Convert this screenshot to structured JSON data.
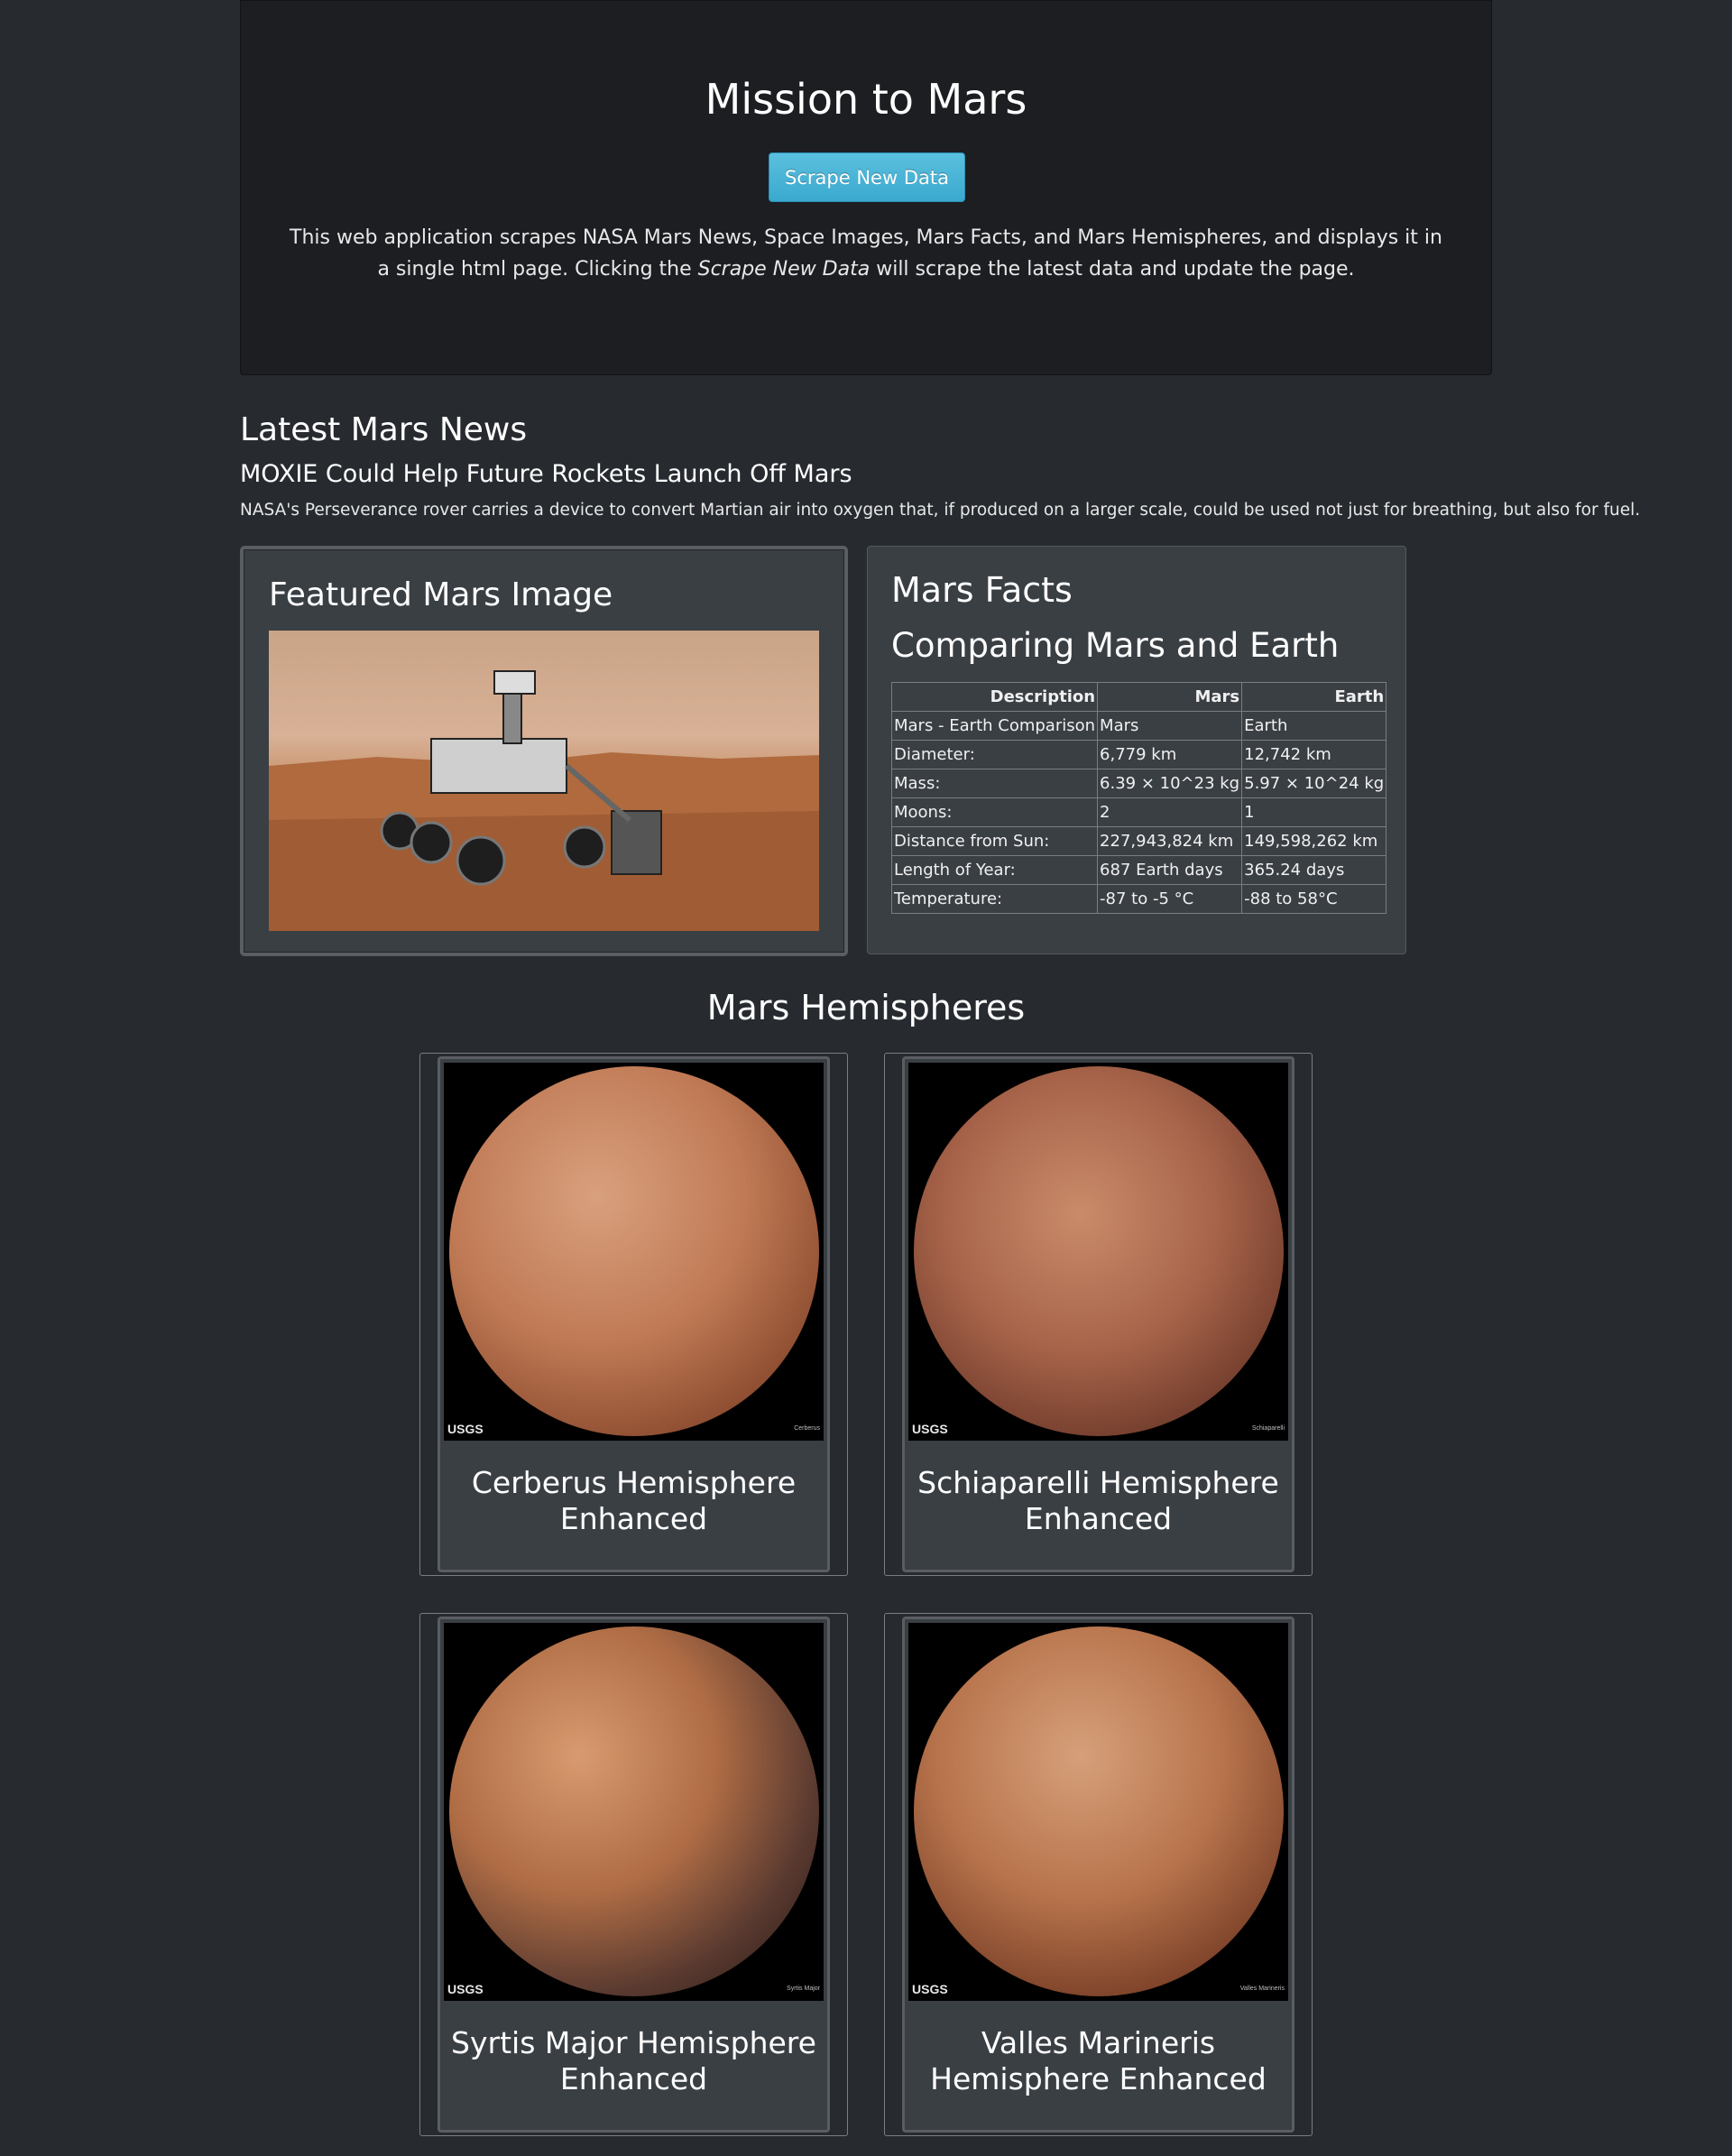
{
  "jumbotron": {
    "title": "Mission to Mars",
    "button_label": "Scrape New Data",
    "desc_before": "This web application scrapes NASA Mars News, Space Images, Mars Facts, and Mars Hemispheres, and displays it in a single html page. Clicking the ",
    "desc_em": "Scrape New Data",
    "desc_after": " will scrape the latest data and update the page."
  },
  "news": {
    "heading": "Latest Mars News",
    "title": "MOXIE Could Help Future Rockets Launch Off Mars",
    "body": "NASA's Perseverance rover carries a device to convert Martian air into oxygen that, if produced on a larger scale, could be used not just for breathing, but also for fuel."
  },
  "featured": {
    "heading": "Featured Mars Image"
  },
  "facts": {
    "heading": "Mars Facts",
    "subheading": "Comparing Mars and Earth",
    "columns": [
      "Description",
      "Mars",
      "Earth"
    ],
    "rows": [
      [
        "Mars - Earth Comparison",
        "Mars",
        "Earth"
      ],
      [
        "Diameter:",
        "6,779 km",
        "12,742 km"
      ],
      [
        "Mass:",
        "6.39 × 10^23 kg",
        "5.97 × 10^24 kg"
      ],
      [
        "Moons:",
        "2",
        "1"
      ],
      [
        "Distance from Sun:",
        "227,943,824 km",
        "149,598,262 km"
      ],
      [
        "Length of Year:",
        "687 Earth days",
        "365.24 days"
      ],
      [
        "Temperature:",
        "-87 to -5 °C",
        "-88 to 58°C"
      ]
    ]
  },
  "hemispheres": {
    "heading": "Mars Hemispheres",
    "items": [
      {
        "title": "Cerberus Hemisphere Enhanced",
        "logo": "USGS",
        "caption": "Cerberus"
      },
      {
        "title": "Schiaparelli Hemisphere Enhanced",
        "logo": "USGS",
        "caption": "Schiaparelli"
      },
      {
        "title": "Syrtis Major Hemisphere Enhanced",
        "logo": "USGS",
        "caption": "Syrtis Major"
      },
      {
        "title": "Valles Marineris Hemisphere Enhanced",
        "logo": "USGS",
        "caption": "Valles Marineris"
      }
    ]
  },
  "colors": {
    "background": "#272b30",
    "panel": "#3a3f44",
    "jumbotron": "#1c1e22",
    "button": "#5bc0de"
  }
}
